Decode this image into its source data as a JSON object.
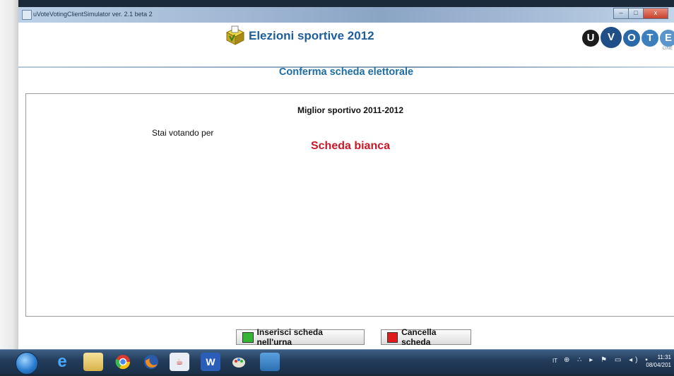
{
  "window": {
    "title": "uVoteVotingClientSimulator ver. 2.1 beta 2",
    "min": "–",
    "max": "□",
    "close": "x"
  },
  "header": {
    "title": "Elezioni sportive 2012",
    "brand_letters": [
      "U",
      "V",
      "O",
      "T",
      "E"
    ],
    "brand_sub": "CINE"
  },
  "page_title": "Conferma scheda elettorale",
  "ballot": {
    "category": "Miglior sportivo 2011-2012",
    "voting_label": "Stai votando per",
    "selection": "Scheda bianca"
  },
  "buttons": {
    "insert": "Inserisci scheda nell'urna",
    "cancel": "Cancella scheda"
  },
  "taskbar": {
    "pinned": [
      "internet-explorer-icon",
      "file-explorer-icon",
      "chrome-icon",
      "firefox-icon",
      "java-icon",
      "word-icon",
      "paint-icon",
      "window-icon"
    ],
    "lang": "IT",
    "tray_icons": "⊕ ∴ ▸ ⚑ ▭ ◂) ▪",
    "time": "11:31",
    "date": "08/04/201"
  },
  "colors": {
    "title_blue": "#1e5f9b",
    "page_title_blue": "#1e6ea3",
    "selection_red": "#c7192a",
    "insert_green": "#35b534",
    "cancel_red": "#e01b1b"
  }
}
